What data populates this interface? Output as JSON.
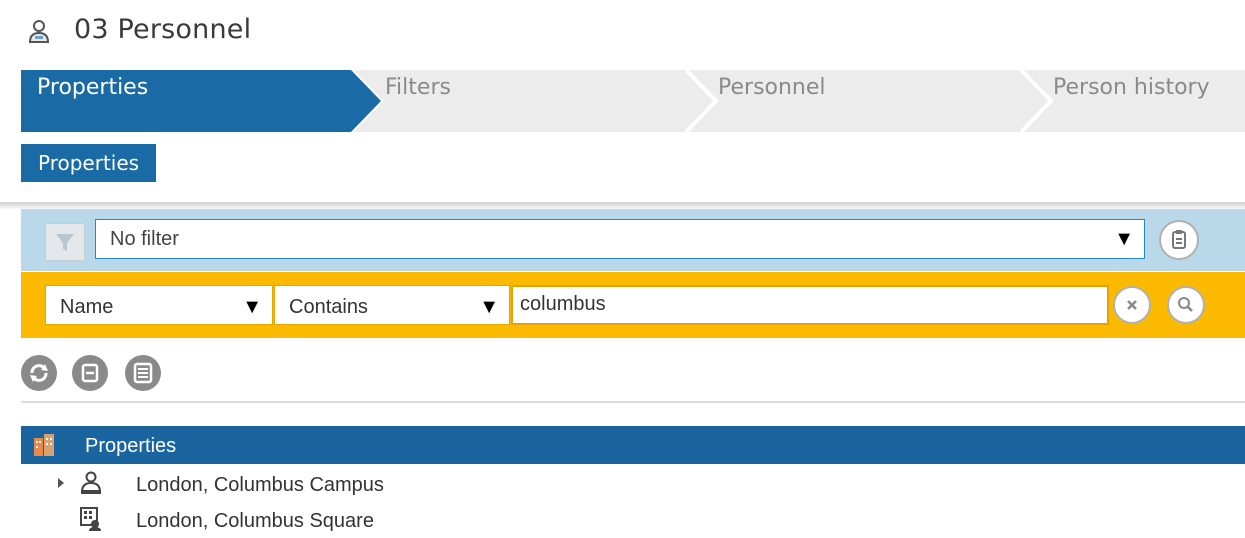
{
  "page": {
    "title": "03 Personnel",
    "title_icon": "person-icon"
  },
  "wizard": {
    "steps": [
      {
        "label": "Properties",
        "active": true
      },
      {
        "label": "Filters",
        "active": false
      },
      {
        "label": "Personnel",
        "active": false
      },
      {
        "label": "Person history",
        "active": false
      }
    ]
  },
  "subtabs": {
    "active_label": "Properties"
  },
  "filter": {
    "selected": "No filter",
    "icon": "funnel-icon",
    "side_button_icon": "clipboard-icon"
  },
  "search": {
    "field": "Name",
    "operator": "Contains",
    "value": "columbus",
    "clear_icon": "close-icon",
    "search_icon": "search-icon"
  },
  "actions": [
    {
      "name": "refresh-icon"
    },
    {
      "name": "collapse-icon"
    },
    {
      "name": "list-icon"
    }
  ],
  "tree": {
    "header_label": "Properties",
    "header_icon": "buildings-icon",
    "items": [
      {
        "label": "London, Columbus Campus",
        "icon": "site-icon",
        "expandable": true
      },
      {
        "label": "London, Columbus Square",
        "icon": "building-icon",
        "expandable": false
      }
    ]
  },
  "colors": {
    "primary_blue": "#1a6aa6",
    "filter_bg": "#b9d9ea",
    "search_bg": "#fbba00",
    "step_inactive": "#ececec"
  }
}
